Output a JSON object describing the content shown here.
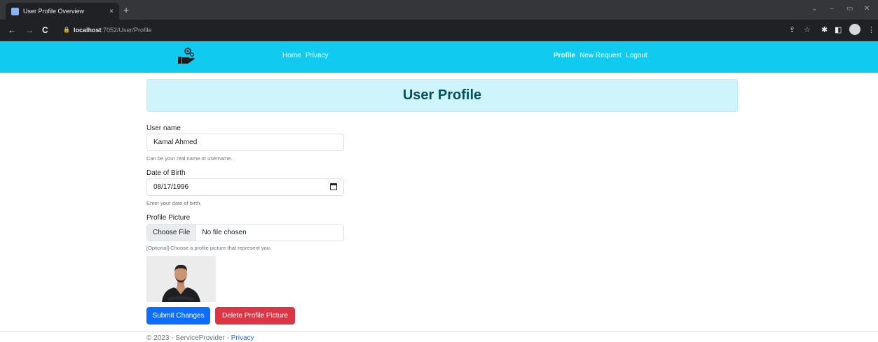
{
  "browser": {
    "tab_title": "User Profile Overview",
    "tab_close": "×",
    "new_tab": "+",
    "back": "←",
    "forward": "→",
    "reload": "C",
    "url_host": "localhost",
    "url_path": ":7052/User/Profile",
    "win_min": "–",
    "win_restore": "▭",
    "win_close": "✕",
    "win_chevron": "⌄"
  },
  "nav": {
    "home": "Home",
    "privacy": "Privacy",
    "profile": "Profile",
    "new_request": "New Request",
    "logout": "Logout"
  },
  "header": {
    "title": "User Profile"
  },
  "form": {
    "username": {
      "label": "User name",
      "value": "Kamal Ahmed",
      "help": "Can be your real name or username."
    },
    "dob": {
      "label": "Date of Birth",
      "value": "08/17/1996",
      "help": "Enter your date of birth."
    },
    "picture": {
      "label": "Profile Picture",
      "button": "Choose File",
      "status": "No file chosen",
      "help": "[Optional] Choose a profile picture that represent you."
    }
  },
  "buttons": {
    "submit": "Submit Changes",
    "delete": "Delete Profile Picture"
  },
  "footer": {
    "text": "© 2023 - ServiceProvider - ",
    "link": "Privacy"
  },
  "colors": {
    "navbar": "#11caf0",
    "header_bg": "#cff4fc",
    "primary": "#0d6efd",
    "danger": "#dc3545"
  },
  "icons": {
    "favicon": "page-icon",
    "calendar": "calendar-icon",
    "logo": "hand-gear-logo"
  }
}
